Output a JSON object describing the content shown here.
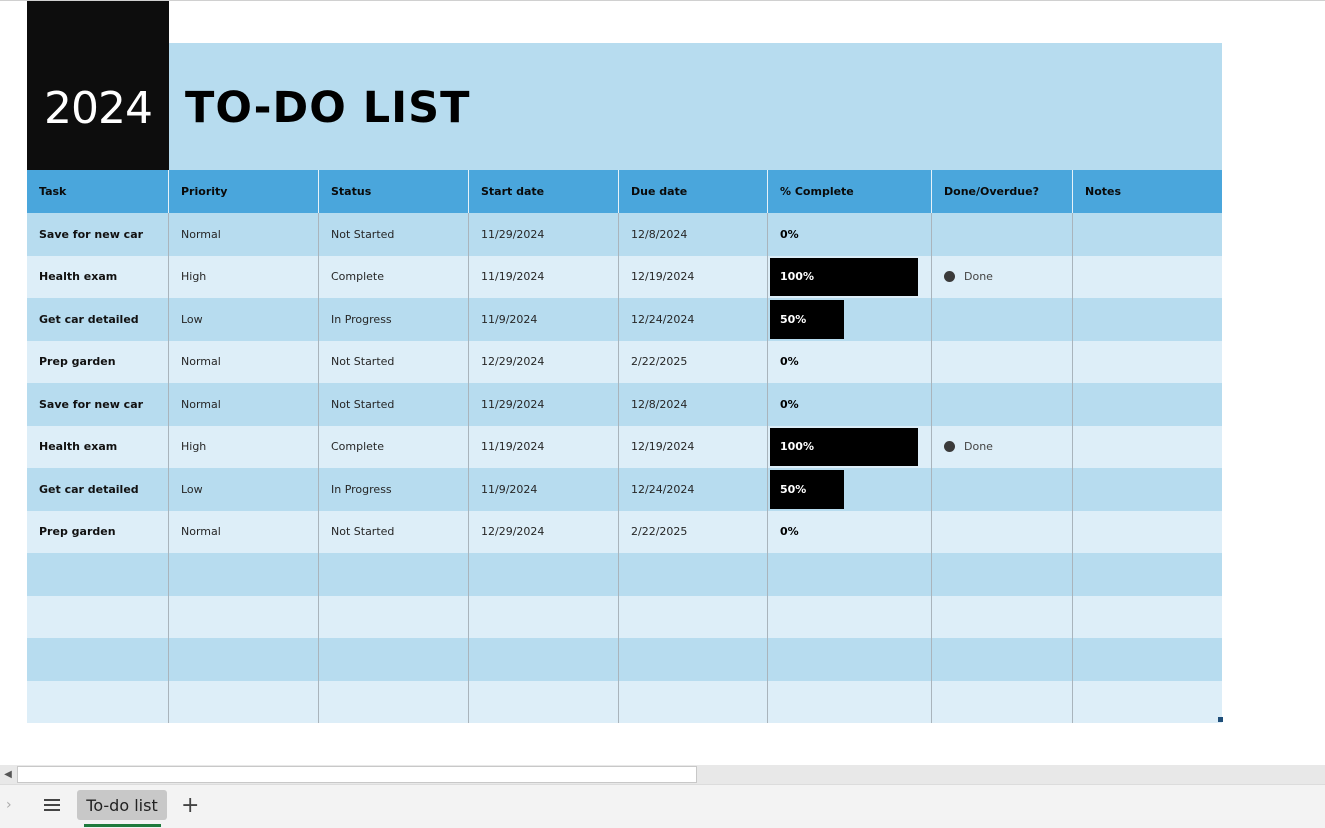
{
  "header": {
    "year": "2024",
    "title": "TO-DO LIST"
  },
  "columns": [
    "Task",
    "Priority",
    "Status",
    "Start date",
    "Due date",
    "% Complete",
    "Done/Overdue?",
    "Notes"
  ],
  "rows": [
    {
      "task": "Save for new car",
      "priority": "Normal",
      "status": "Not Started",
      "start": "11/29/2024",
      "due": "12/8/2024",
      "pct_label": "0%",
      "pct": 0,
      "done": ""
    },
    {
      "task": "Health exam",
      "priority": "High",
      "status": "Complete",
      "start": "11/19/2024",
      "due": "12/19/2024",
      "pct_label": "100%",
      "pct": 1.0,
      "done": "Done"
    },
    {
      "task": "Get car detailed",
      "priority": "Low",
      "status": "In Progress",
      "start": "11/9/2024",
      "due": "12/24/2024",
      "pct_label": "50%",
      "pct": 0.5,
      "done": ""
    },
    {
      "task": "Prep garden",
      "priority": "Normal",
      "status": "Not Started",
      "start": "12/29/2024",
      "due": "2/22/2025",
      "pct_label": "0%",
      "pct": 0,
      "done": ""
    },
    {
      "task": "Save for new car",
      "priority": "Normal",
      "status": "Not Started",
      "start": "11/29/2024",
      "due": "12/8/2024",
      "pct_label": "0%",
      "pct": 0,
      "done": ""
    },
    {
      "task": "Health exam",
      "priority": "High",
      "status": "Complete",
      "start": "11/19/2024",
      "due": "12/19/2024",
      "pct_label": "100%",
      "pct": 1.0,
      "done": "Done"
    },
    {
      "task": "Get car detailed",
      "priority": "Low",
      "status": "In Progress",
      "start": "11/9/2024",
      "due": "12/24/2024",
      "pct_label": "50%",
      "pct": 0.5,
      "done": ""
    },
    {
      "task": "Prep garden",
      "priority": "Normal",
      "status": "Not Started",
      "start": "12/29/2024",
      "due": "2/22/2025",
      "pct_label": "0%",
      "pct": 0,
      "done": ""
    }
  ],
  "empty_rows": 4,
  "sheet_tabs": {
    "active": "To-do list",
    "add_icon": "plus-icon",
    "menu_icon": "hamburger-icon"
  },
  "colors": {
    "header_band": "#4aa6dc",
    "title_band": "#b7dcef",
    "row_dark": "#b7dcef",
    "row_light": "#ddeef8",
    "year_block": "#0d0d0d",
    "progress_bar": "#000000"
  }
}
